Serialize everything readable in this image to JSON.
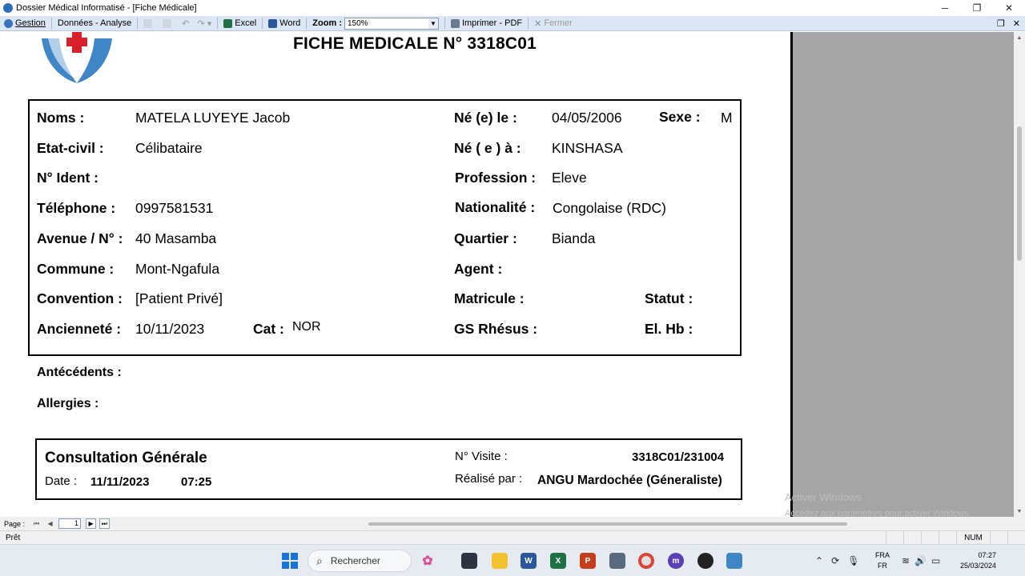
{
  "window": {
    "title": "Dossier Médical Informatisé - [Fiche Médicale]",
    "controls": [
      "─",
      "❐",
      "✕"
    ]
  },
  "toolbar": {
    "gestion": "Gestion",
    "donnees": "Données - Analyse",
    "excel": "Excel",
    "word": "Word",
    "zoom_label": "Zoom :",
    "zoom_value": "150%",
    "imprimer": "Imprimer - PDF",
    "fermer": "Fermer",
    "icon_colors": {
      "excel": "#1e7145",
      "word": "#2b579a",
      "imprimer": "#6b7a8f",
      "fermer": "#7d8ea8"
    }
  },
  "report": {
    "title": "FICHE MEDICALE N° 3318C01",
    "patient": {
      "noms_label": "Noms :",
      "noms": "MATELA LUYEYE Jacob",
      "ne_le_label": "Né (e) le :",
      "ne_le": "04/05/2006",
      "sexe_label": "Sexe :",
      "sexe": "M",
      "etat_label": "Etat-civil :",
      "etat": "Célibataire",
      "ne_a_label": "Né ( e ) à :",
      "ne_a": "KINSHASA",
      "ident_label": "N° Ident :",
      "profession_label": "Profession :",
      "profession": "Eleve",
      "telephone_label": "Téléphone :",
      "telephone": "0997581531",
      "nationalite_label": "Nationalité :",
      "nationalite": "Congolaise (RDC)",
      "avenue_label": "Avenue / N° :",
      "avenue": "40 Masamba",
      "quartier_label": "Quartier :",
      "quartier": "Bianda",
      "commune_label": "Commune :",
      "commune": "Mont-Ngafula",
      "agent_label": "Agent :",
      "convention_label": "Convention :",
      "convention": "[Patient Privé]",
      "matricule_label": "Matricule :",
      "statut_label": "Statut :",
      "anciennete_label": "Ancienneté :",
      "anciennete": "10/11/2023",
      "cat_label": "Cat :",
      "cat": "NOR",
      "gs_label": "GS Rhésus :",
      "elhb_label": "El. Hb :"
    },
    "antecedents_label": "Antécédents :",
    "allergies_label": "Allergies :",
    "consultation": {
      "title": "Consultation Générale",
      "date_label": "Date :",
      "date": "11/11/2023",
      "time": "07:25",
      "visite_label": "N° Visite :",
      "visite": "3318C01/231004",
      "realise_label": "Réalisé par :",
      "realise": "ANGU Mardochée (Géneraliste)"
    },
    "watermark": [
      "Activer Windows",
      "Accédez aux paramètres pour activer Windows."
    ]
  },
  "pagebar": {
    "label": "Page :",
    "current": "1"
  },
  "statusbar": {
    "text": "Prêt",
    "num": "NUM"
  },
  "taskbar": {
    "search": "Rechercher",
    "lang_top": "FRA",
    "lang_bottom": "FR",
    "time": "07:27",
    "date": "25/03/2024"
  }
}
